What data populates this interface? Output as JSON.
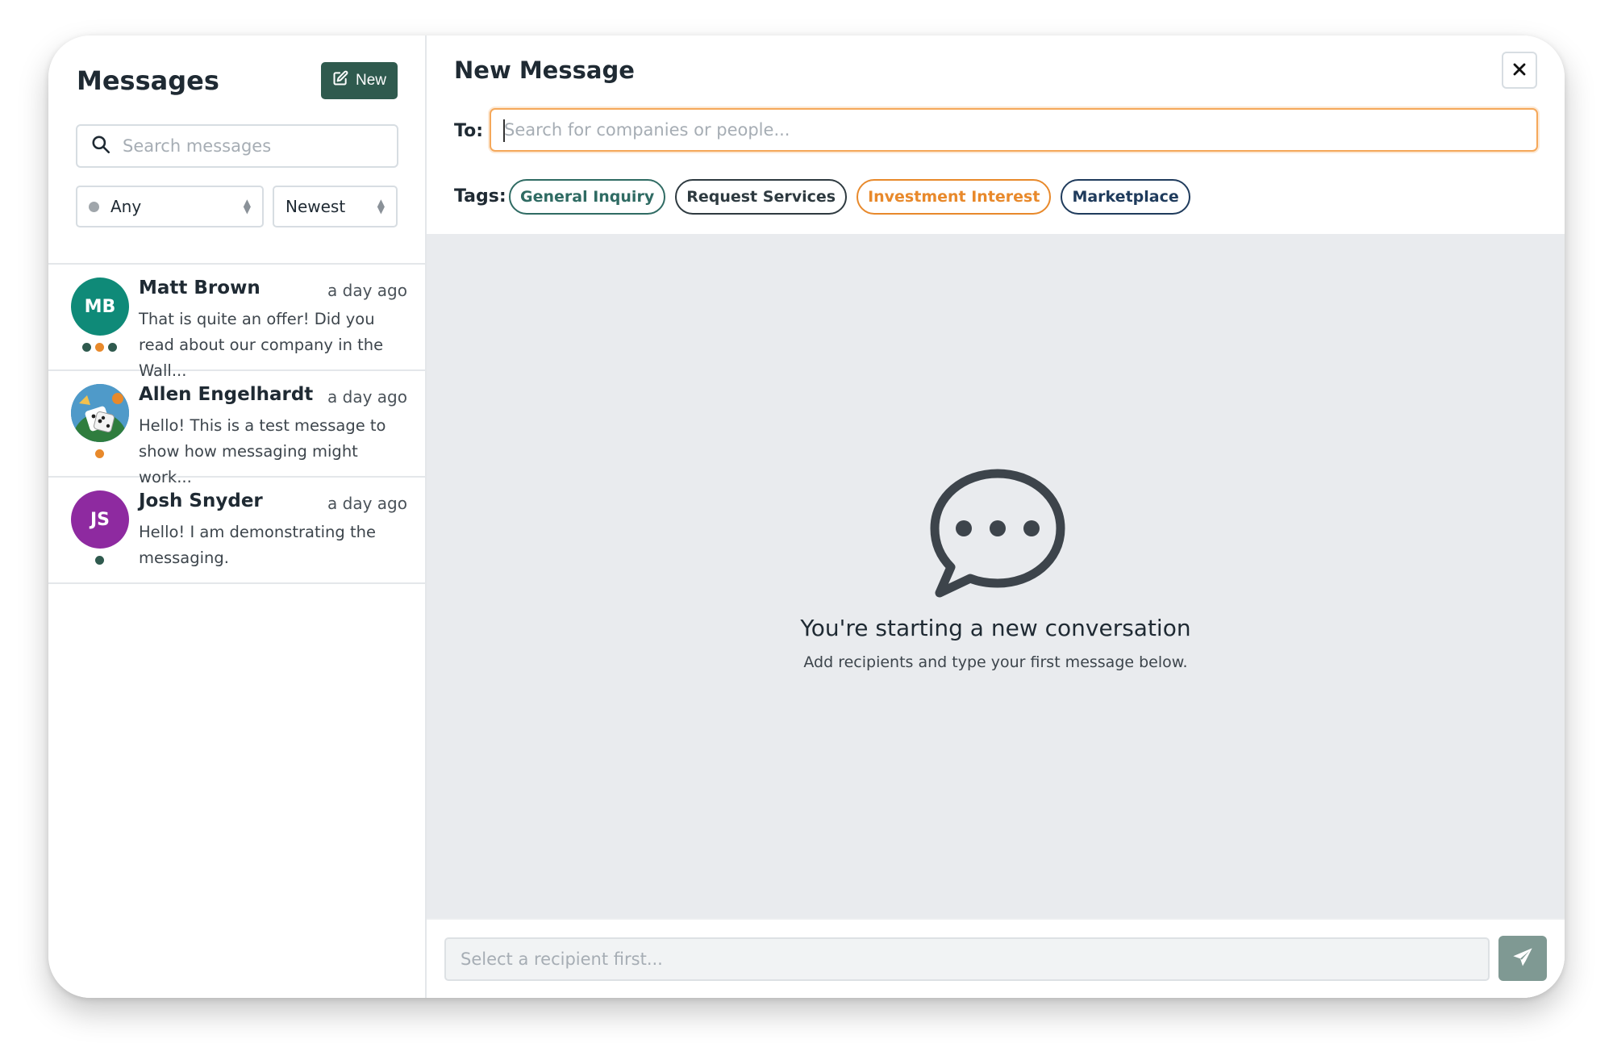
{
  "sidebar": {
    "title": "Messages",
    "new_button_label": "New",
    "search_placeholder": "Search messages",
    "status_filter": "Any",
    "sort_filter": "Newest",
    "conversations": [
      {
        "initials": "MB",
        "name": "Matt Brown",
        "time": "a day ago",
        "preview": "That is quite an offer! Did you read about our company in the Wall...",
        "avatar_color": "#0f8a78",
        "status_dot_colors": [
          "#2f5a4e",
          "#e8892b",
          "#2f5a4e"
        ]
      },
      {
        "initials": "",
        "name": "Allen Engelhardt",
        "time": "a day ago",
        "preview": "Hello! This is a test message to show how messaging might work...",
        "avatar_color": "#3a87b8",
        "status_dot_colors": [
          "#e8892b"
        ]
      },
      {
        "initials": "JS",
        "name": "Josh Snyder",
        "time": "a day ago",
        "preview": "Hello! I am demonstrating the messaging.",
        "avatar_color": "#8e2aa0",
        "status_dot_colors": [
          "#2f5a4e"
        ]
      }
    ]
  },
  "main": {
    "title": "New Message",
    "to_label": "To:",
    "to_placeholder": "Search for companies or people...",
    "tags_label": "Tags:",
    "tags": [
      {
        "label": "General Inquiry",
        "color": "#2f6b63"
      },
      {
        "label": "Request Services",
        "color": "#2e3a40"
      },
      {
        "label": "Investment Interest",
        "color": "#e8892b"
      },
      {
        "label": "Marketplace",
        "color": "#1f3b5c"
      }
    ],
    "empty_title": "You're starting a new conversation",
    "empty_subtitle": "Add recipients and type your first message below.",
    "message_placeholder": "Select a recipient first..."
  },
  "colors": {
    "brand": "#2f5a4e",
    "accent_orange": "#e8892b",
    "send_button": "#7f9993",
    "empty_bg": "#e9ebee"
  },
  "icons": [
    "edit-icon",
    "search-icon",
    "chevron-updown-icon",
    "close-icon",
    "chat-bubble-icon",
    "send-icon"
  ]
}
